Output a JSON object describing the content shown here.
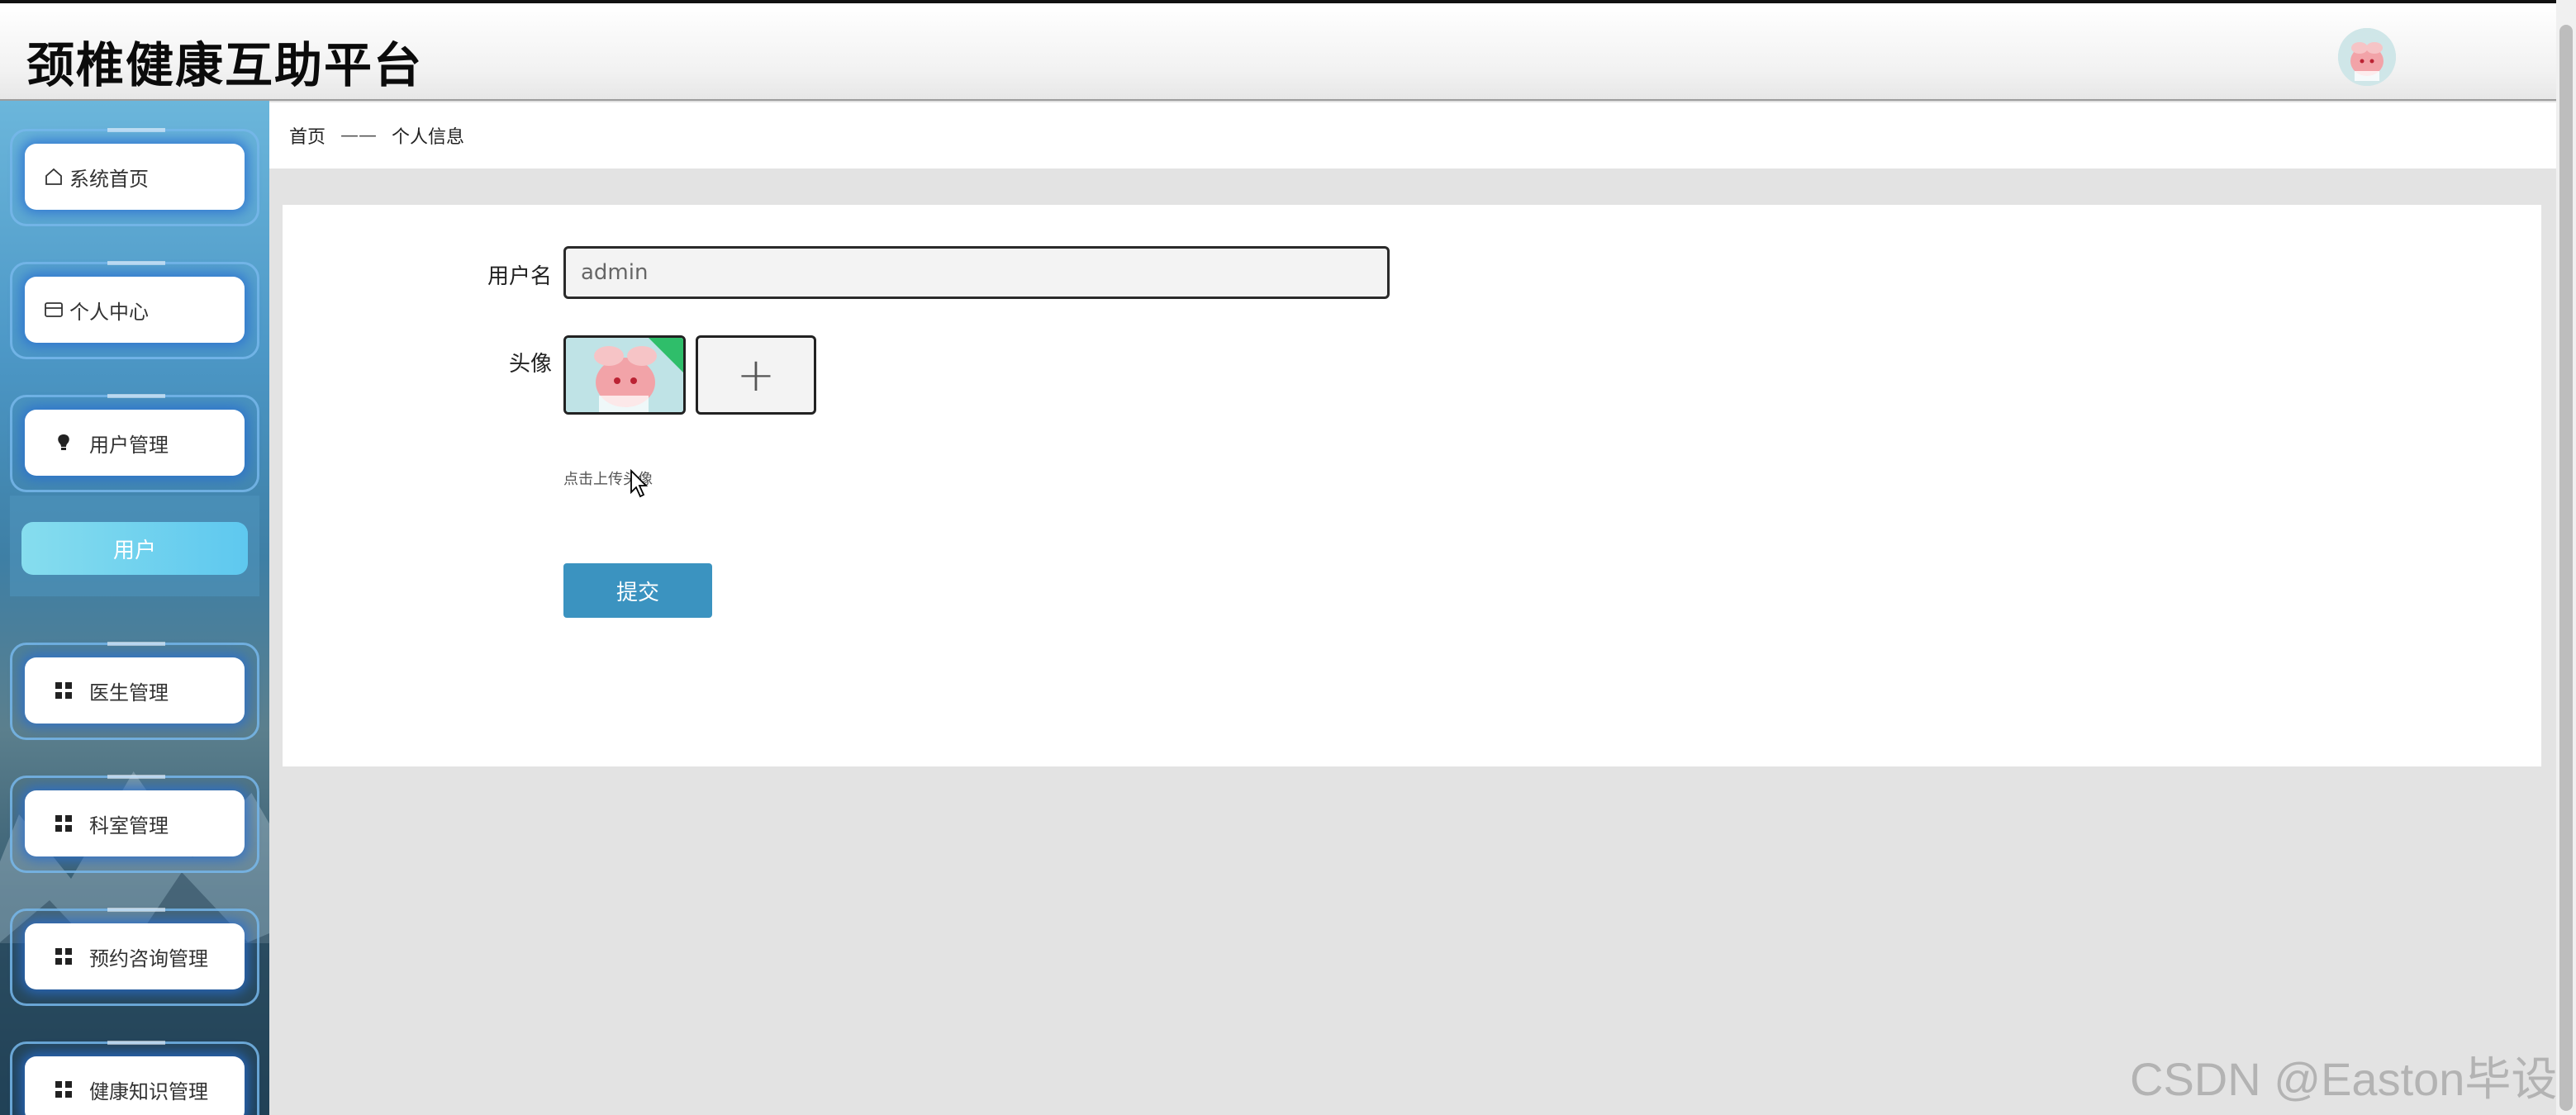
{
  "header": {
    "title": "颈椎健康互助平台",
    "avatar_icon": "user-avatar-icon"
  },
  "sidebar": {
    "items": [
      {
        "label": "系统首页",
        "icon": "home-icon"
      },
      {
        "label": "个人中心",
        "icon": "card-icon"
      },
      {
        "label": "用户管理",
        "icon": "lightbulb-icon"
      },
      {
        "label": "医生管理",
        "icon": "grid-icon"
      },
      {
        "label": "科室管理",
        "icon": "grid-icon"
      },
      {
        "label": "预约咨询管理",
        "icon": "grid-icon"
      },
      {
        "label": "健康知识管理",
        "icon": "grid-icon"
      }
    ],
    "sub_items": [
      {
        "label": "用户",
        "active": true
      }
    ],
    "colors": {
      "active_sub_start": "#86ddee",
      "active_sub_end": "#5ec8ef",
      "glow": "#286ed2"
    }
  },
  "breadcrumb": {
    "home": "首页",
    "separator": "——",
    "current": "个人信息"
  },
  "form": {
    "username_label": "用户名",
    "username_value": "admin",
    "avatar_label": "头像",
    "upload_plus": "+",
    "upload_hint": "点击上传头像",
    "submit_label": "提交",
    "submit_color": "#3b93c0"
  },
  "watermark": "CSDN @Easton毕设"
}
